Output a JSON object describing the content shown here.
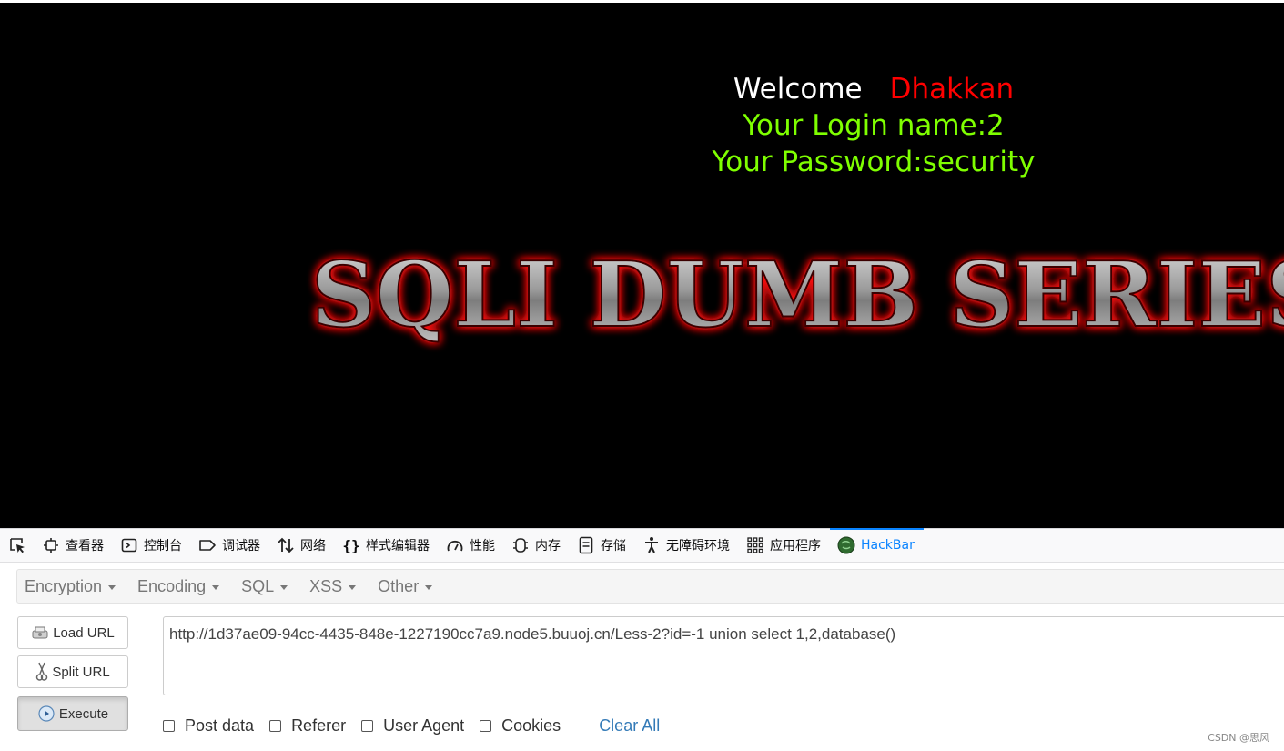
{
  "page": {
    "welcome": "Welcome",
    "username": "Dhakkan",
    "login_line": "Your Login name:2",
    "password_line": "Your Password:security",
    "banner_text": "SQLI DUMB SERIES"
  },
  "devtools": {
    "tabs": [
      {
        "label": "查看器",
        "icon": "inspector-icon"
      },
      {
        "label": "控制台",
        "icon": "console-icon"
      },
      {
        "label": "调试器",
        "icon": "debugger-icon"
      },
      {
        "label": "网络",
        "icon": "network-icon"
      },
      {
        "label": "样式编辑器",
        "icon": "style-editor-icon"
      },
      {
        "label": "性能",
        "icon": "performance-icon"
      },
      {
        "label": "内存",
        "icon": "memory-icon"
      },
      {
        "label": "存储",
        "icon": "storage-icon"
      },
      {
        "label": "无障碍环境",
        "icon": "accessibility-icon"
      },
      {
        "label": "应用程序",
        "icon": "application-icon"
      },
      {
        "label": "HackBar",
        "icon": "hackbar-icon",
        "active": true
      }
    ]
  },
  "hackbar": {
    "menus": [
      "Encryption",
      "Encoding",
      "SQL",
      "XSS",
      "Other"
    ],
    "load_url": "Load URL",
    "split_url": "Split URL",
    "execute": "Execute",
    "url": "http://1d37ae09-94cc-4435-848e-1227190cc7a9.node5.buuoj.cn/Less-2?id=-1 union select 1,2,database()",
    "options": [
      "Post data",
      "Referer",
      "User Agent",
      "Cookies"
    ],
    "clear_all": "Clear All"
  },
  "watermark": "CSDN @思风",
  "colors": {
    "page_bg": "#000000",
    "welcome": "#ffffff",
    "username": "#ff0000",
    "credentials": "#7fff00",
    "accent": "#0a84ff",
    "link": "#337ab7"
  }
}
